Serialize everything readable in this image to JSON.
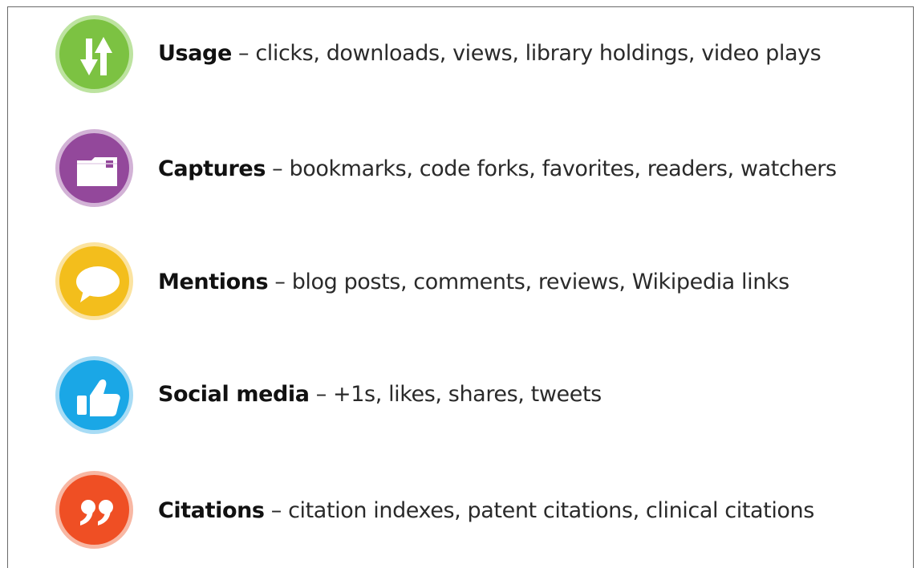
{
  "items": [
    {
      "term": "Usage",
      "sep": " – ",
      "desc": "clicks, downloads, views, library holdings, video plays",
      "icon": "arrows-up-down-icon",
      "color": "#7cc242",
      "ring": "#bde3a0"
    },
    {
      "term": "Captures",
      "sep": " – ",
      "desc": "bookmarks, code forks, favorites, readers, watchers",
      "icon": "folder-icon",
      "color": "#93489b",
      "ring": "#d2b2d6"
    },
    {
      "term": "Mentions",
      "sep": " – ",
      "desc": "blog posts, comments, reviews, Wikipedia links",
      "icon": "speech-bubble-icon",
      "color": "#f3be1c",
      "ring": "#fbe3a0"
    },
    {
      "term": "Social media",
      "sep": " – ",
      "desc": "+1s, likes, shares, tweets",
      "icon": "thumbs-up-icon",
      "color": "#1aa7e6",
      "ring": "#a8dcf5"
    },
    {
      "term": "Citations",
      "sep": " – ",
      "desc": "citation indexes, patent citations, clinical citations",
      "icon": "quote-icon",
      "color": "#ef4f24",
      "ring": "#f8b7a3"
    }
  ]
}
